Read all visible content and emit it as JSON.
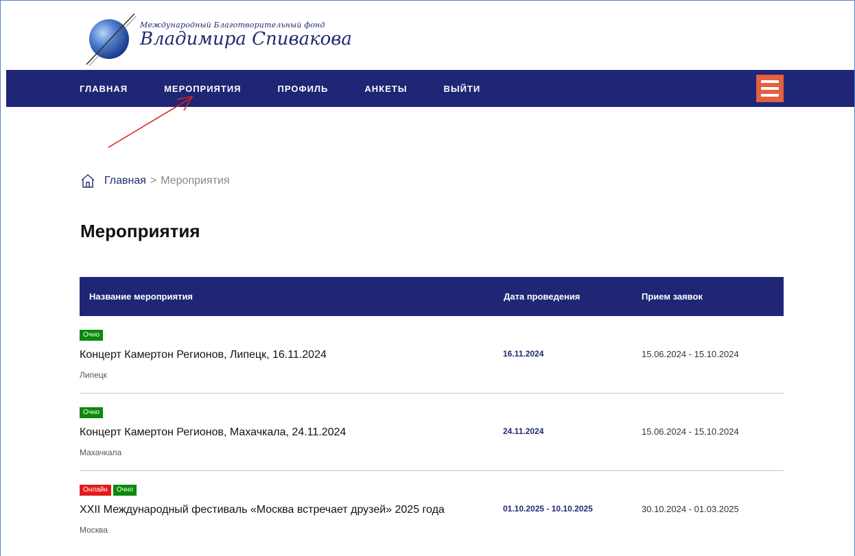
{
  "logo": {
    "line1": "Международный Благотворительный фонд",
    "line2": "Владимира Спивакова"
  },
  "nav": {
    "items": [
      "ГЛАВНАЯ",
      "МЕРОПРИЯТИЯ",
      "ПРОФИЛЬ",
      "АНКЕТЫ",
      "ВЫЙТИ"
    ]
  },
  "breadcrumb": {
    "home": "Главная",
    "separator": ">",
    "current": "Мероприятия"
  },
  "page_title": "Мероприятия",
  "table": {
    "headers": {
      "name": "Название мероприятия",
      "date": "Дата проведения",
      "apps": "Прием заявок"
    },
    "rows": [
      {
        "badges": [
          "Очно"
        ],
        "title": "Концерт Камертон Регионов, Липецк, 16.11.2024",
        "city": "Липецк",
        "date": "16.11.2024",
        "apps": "15.06.2024 - 15.10.2024"
      },
      {
        "badges": [
          "Очно"
        ],
        "title": "Концерт Камертон Регионов, Махачкала, 24.11.2024",
        "city": "Махачкала",
        "date": "24.11.2024",
        "apps": "15.06.2024 - 15.10.2024"
      },
      {
        "badges": [
          "Онлайн",
          "Очно"
        ],
        "title": "XXII Международный фестиваль «Москва встречает друзей» 2025 года",
        "city": "Москва",
        "date": "01.10.2025 - 10.10.2025",
        "apps": "30.10.2024 - 01.03.2025"
      }
    ]
  },
  "colors": {
    "nav_bg": "#1f2676",
    "burger_bg": "#e4603f",
    "badge_ochno": "#0a8a0a",
    "badge_online": "#e31b1b",
    "annotation_arrow": "#e02020"
  }
}
